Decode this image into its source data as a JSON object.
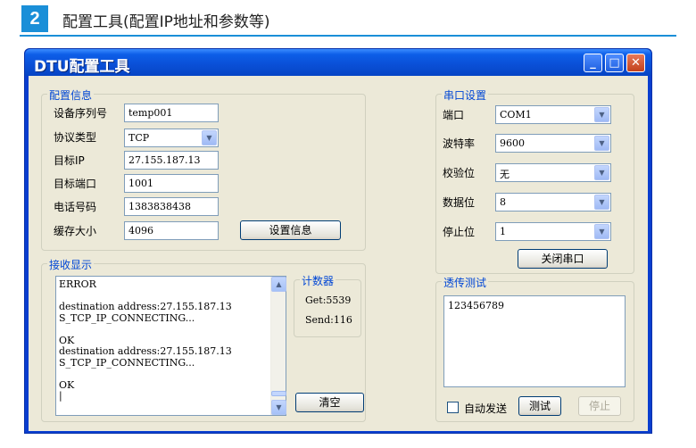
{
  "header": {
    "number": "2",
    "title": "配置工具(配置IP地址和参数等)"
  },
  "window": {
    "title": "DTU配置工具",
    "buttons": {
      "minimize": "_",
      "maximize": "□",
      "close": "✕"
    }
  },
  "config": {
    "group_title": "配置信息",
    "serial_label": "设备序列号",
    "serial_value": "temp001",
    "protocol_label": "协议类型",
    "protocol_value": "TCP",
    "target_ip_label": "目标IP",
    "target_ip_value": "27.155.187.13",
    "target_port_label": "目标端口",
    "target_port_value": "1001",
    "phone_label": "电话号码",
    "phone_value": "1383838438",
    "cache_label": "缓存大小",
    "cache_value": "4096",
    "set_button": "设置信息"
  },
  "serial": {
    "group_title": "串口设置",
    "port_label": "端口",
    "port_value": "COM1",
    "baud_label": "波特率",
    "baud_value": "9600",
    "parity_label": "校验位",
    "parity_value": "无",
    "databits_label": "数据位",
    "databits_value": "8",
    "stopbits_label": "停止位",
    "stopbits_value": "1",
    "close_button": "关闭串口"
  },
  "receive": {
    "group_title": "接收显示",
    "text": "ERROR\n\ndestination address:27.155.187.13\nS_TCP_IP_CONNECTING...\n\nOK\ndestination address:27.155.187.13\nS_TCP_IP_CONNECTING...\n\nOK\n|",
    "counter_title": "计数器",
    "get_text": "Get:5539",
    "send_text": "Send:116",
    "clear_button": "清空"
  },
  "passthrough": {
    "group_title": "透传测试",
    "text": "123456789",
    "auto_send_label": "自动发送",
    "auto_send_checked": false,
    "test_button": "测试",
    "stop_button": "停止"
  }
}
